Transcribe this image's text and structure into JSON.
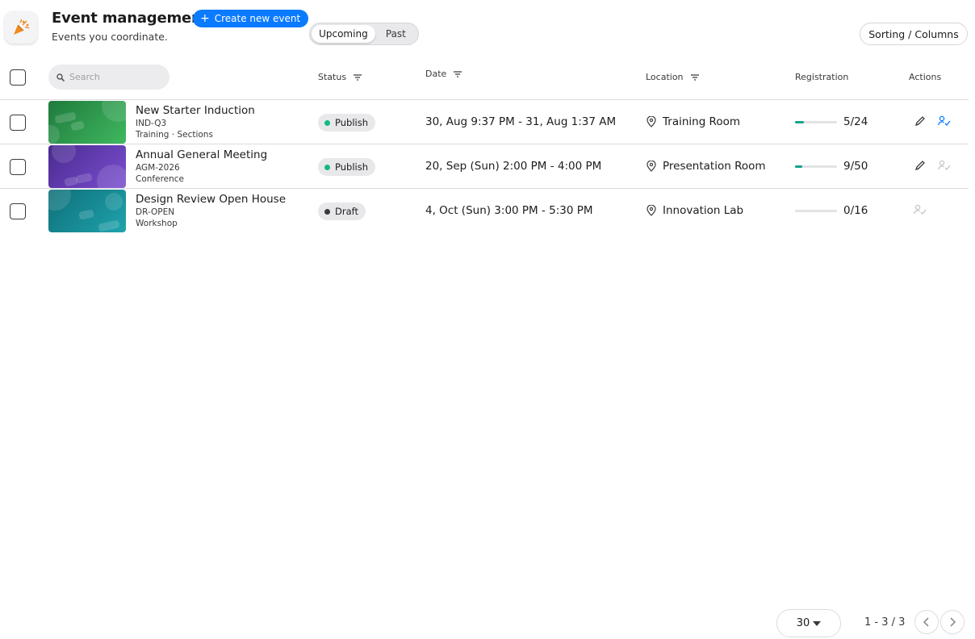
{
  "header": {
    "title": "Event management",
    "subtitle": "Events you coordinate.",
    "create_label": "Create new event",
    "tabs": [
      {
        "label": "Upcoming",
        "active": true
      },
      {
        "label": "Past",
        "active": false
      }
    ],
    "sort_label": "Sorting / Columns"
  },
  "search": {
    "placeholder": "Search"
  },
  "columns": {
    "status": "Status",
    "date": "Date",
    "location": "Location",
    "registration": "Registration",
    "actions": "Actions"
  },
  "events": [
    {
      "name": "New Starter Induction",
      "code": "IND-Q3",
      "category": "Training · Sections",
      "status": "Publish",
      "date": "30, Aug 9:37 PM - 31, Aug 1:37 AM",
      "location": "Training Room",
      "registration": "5/24",
      "fill_fraction": 0.208,
      "thumb_color": "#2e9b4f"
    },
    {
      "name": "Annual General Meeting",
      "code": "AGM-2026",
      "category": "Conference",
      "status": "Publish",
      "date": "20, Sep (Sun) 2:00 PM - 4:00 PM",
      "location": "Presentation Room",
      "registration": "9/50",
      "fill_fraction": 0.18,
      "thumb_color": "#6a3fb8"
    },
    {
      "name": "Design Review Open House",
      "code": "DR-OPEN",
      "category": "Workshop",
      "status": "Draft",
      "date": "4, Oct (Sun) 3:00 PM - 5:30 PM",
      "location": "Innovation Lab",
      "registration": "0/16",
      "fill_fraction": 0,
      "thumb_color": "#16858f"
    }
  ],
  "colors": {
    "accent": "#0a7aff",
    "publish_dot": "#12b886",
    "draft_dot": "#3a3a3c",
    "progress": "#10a38d"
  },
  "pagination": {
    "per_page": "30",
    "range": "1 - 3 / 3"
  }
}
